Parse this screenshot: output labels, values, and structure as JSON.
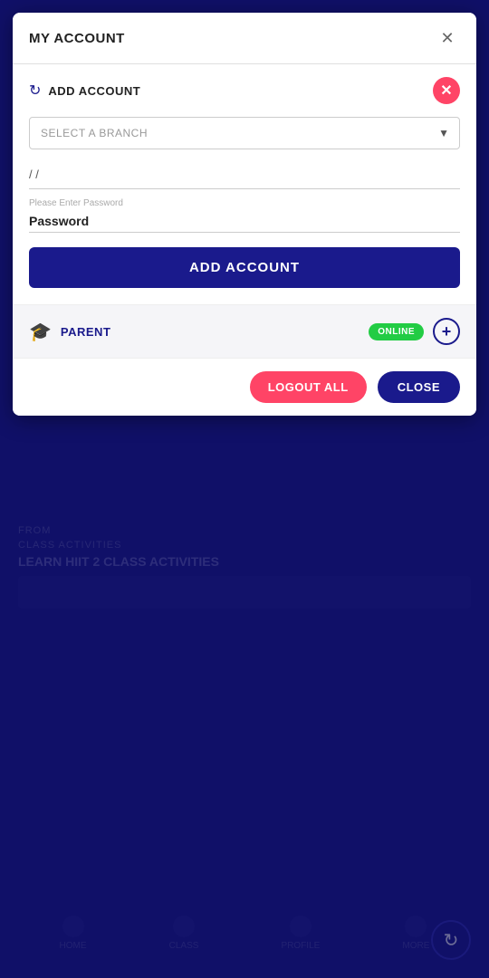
{
  "background": {
    "label": "CLASS ACTIVITIES",
    "label2": "FROM",
    "title": "LEARN HIIT 2 CLASS ACTIVITIES",
    "footer_items": [
      "HOME",
      "CLASS",
      "PROFILE",
      "MORE"
    ]
  },
  "refresh_fab": {
    "icon": "↻"
  },
  "modal": {
    "title": "MY ACCOUNT",
    "close_icon": "✕",
    "add_account_section": {
      "label": "ADD ACCOUNT",
      "close_x_icon": "✕",
      "branch_select": {
        "placeholder": "SELECT A BRANCH",
        "options": [
          "SELECT A BRANCH"
        ]
      },
      "date_input": {
        "value": "/ /",
        "placeholder": "/ /"
      },
      "password_field": {
        "placeholder": "Please Enter Password",
        "value": "Password"
      },
      "add_button_label": "ADD ACCOUNT"
    },
    "accounts": [
      {
        "icon": "🎓",
        "name": "PARENT",
        "status": "ONLINE",
        "status_color": "#22cc44"
      }
    ],
    "footer": {
      "logout_all_label": "LOGOUT ALL",
      "close_label": "CLOSE"
    }
  }
}
